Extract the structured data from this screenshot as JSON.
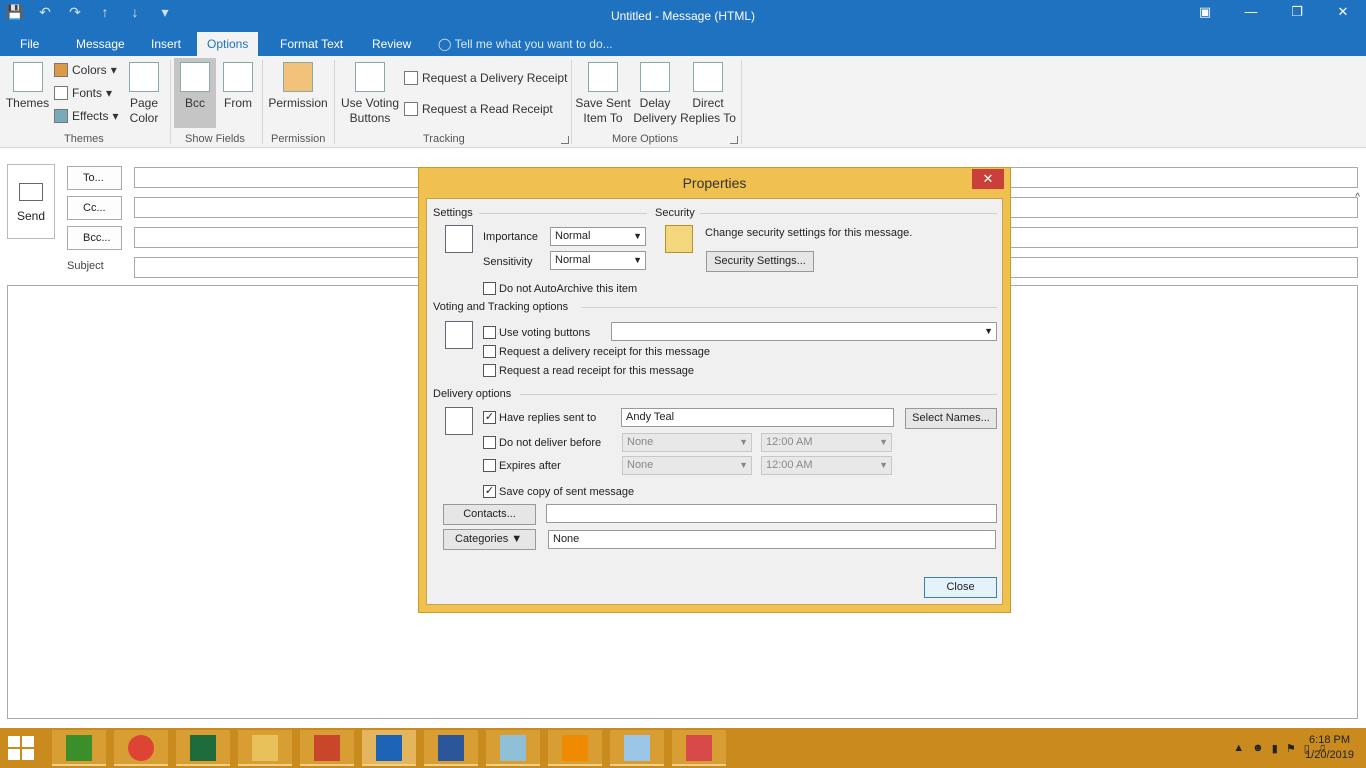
{
  "window": {
    "title": "Untitled - Message (HTML)"
  },
  "quick_access": [
    "save-icon",
    "undo-icon",
    "redo-icon",
    "up-icon",
    "down-icon",
    "customize-icon"
  ],
  "tabs": [
    "File",
    "Message",
    "Insert",
    "Options",
    "Format Text",
    "Review"
  ],
  "tell_me": "Tell me what you want to do...",
  "ribbon": {
    "themes": {
      "themes": "Themes",
      "colors": "Colors",
      "fonts": "Fonts",
      "effects": "Effects",
      "page_color_1": "Page",
      "page_color_2": "Color",
      "group": "Themes"
    },
    "show_fields": {
      "bcc": "Bcc",
      "from": "From",
      "group": "Show Fields"
    },
    "permission": {
      "permission": "Permission",
      "group": "Permission"
    },
    "tracking": {
      "voting_1": "Use Voting",
      "voting_2": "Buttons",
      "delivery_receipt": "Request a Delivery Receipt",
      "read_receipt": "Request a Read Receipt",
      "group": "Tracking"
    },
    "more_options": {
      "save_sent_1": "Save Sent",
      "save_sent_2": "Item To",
      "delay_1": "Delay",
      "delay_2": "Delivery",
      "direct_1": "Direct",
      "direct_2": "Replies To",
      "group": "More Options"
    }
  },
  "message": {
    "send": "Send",
    "to": "To...",
    "cc": "Cc...",
    "bcc": "Bcc...",
    "subject": "Subject"
  },
  "dialog": {
    "title": "Properties",
    "settings": "Settings",
    "importance_label": "Importance",
    "importance_value": "Normal",
    "sensitivity_label": "Sensitivity",
    "sensitivity_value": "Normal",
    "security": "Security",
    "security_text": "Change security settings for this message.",
    "security_button": "Security Settings...",
    "autoarchive": "Do not AutoArchive this item",
    "voting_section": "Voting and Tracking options",
    "use_voting": "Use voting buttons",
    "delivery_receipt": "Request a delivery receipt for this message",
    "read_receipt": "Request a read receipt for this message",
    "delivery_section": "Delivery options",
    "replies_label": "Have replies sent to",
    "replies_value": "Andy Teal",
    "select_names": "Select Names...",
    "not_before_label": "Do not deliver before",
    "not_before_date": "None",
    "not_before_time": "12:00 AM",
    "expires_label": "Expires after",
    "expires_date": "None",
    "expires_time": "12:00 AM",
    "save_copy": "Save copy of sent message",
    "contacts_button": "Contacts...",
    "categories_button": "Categories",
    "categories_value": "None",
    "close_button": "Close",
    "checked": {
      "autoarchive": false,
      "use_voting": false,
      "delivery_receipt": false,
      "read_receipt": false,
      "replies": true,
      "not_before": false,
      "expires": false,
      "save_copy": true
    }
  },
  "taskbar": {
    "apps": [
      "store-icon",
      "chrome-icon",
      "excel-icon",
      "file-explorer-icon",
      "powerpoint-icon",
      "outlook-icon",
      "word-icon",
      "photos-icon",
      "vlc-icon",
      "notepad-icon",
      "snipping-tool-icon"
    ],
    "time": "6:18 PM",
    "date": "1/20/2019"
  },
  "colors": {
    "accent": "#1e72bf",
    "taskbar": "#c98b1e",
    "dialog_frame": "#f0c050",
    "close_red": "#c9403a"
  }
}
